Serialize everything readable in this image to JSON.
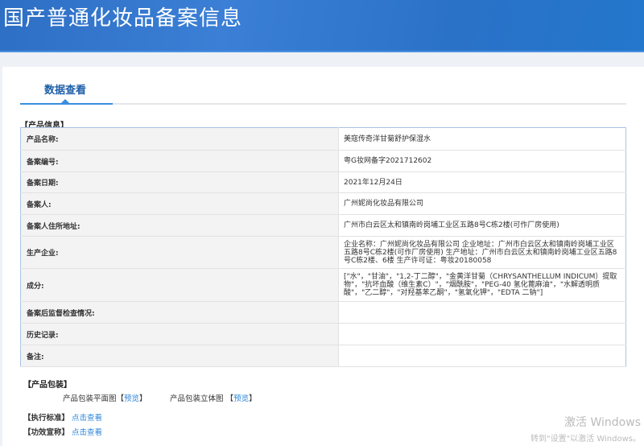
{
  "header": {
    "title": "国产普通化妆品备案信息"
  },
  "tabs": [
    {
      "label": "数据查看",
      "active": true
    }
  ],
  "product_info": {
    "section_title": "【产品信息】",
    "rows": [
      {
        "label": "产品名称:",
        "value": "美寇传奇洋甘菊舒护保湿水"
      },
      {
        "label": "备案编号:",
        "value": "粤G妆网备字2021712602"
      },
      {
        "label": "备案日期:",
        "value": "2021年12月24日"
      },
      {
        "label": "备案人:",
        "value": "广州妮尚化妆品有限公司"
      },
      {
        "label": "备案人住所地址:",
        "value": "广州市白云区太和镇南岭岗埔工业区五路8号C栋2楼(可作厂房使用)"
      },
      {
        "label": "生产企业:",
        "value": "企业名称：广州妮尚化妆品有限公司 企业地址：广州市白云区太和镇南岭岗埔工业区五路8号C栋2楼(可作厂房使用)  生产地址：广州市白云区太和镇南岭岗埔工业区五路8号C栋2楼、6楼 生产许可证：粤妆20180058"
      },
      {
        "label": "成分:",
        "value": "[\"水\"，\"甘油\"，\"1,2-丁二醇\"，\"金黄洋甘菊（CHRYSANTHELLUM INDICUM）提取物\"，\"抗坏血酸（维生素C）\"，\"烟酰胺\"，\"PEG-40 氢化蓖麻油\"，\"水解透明质酸\"，\"乙二醇\"，\"对羟基苯乙酮\"，\"氢氧化钾\"，\"EDTA 二钠\"]"
      },
      {
        "label": "备案后监督检查情况:",
        "value": ""
      },
      {
        "label": "历史记录:",
        "value": ""
      },
      {
        "label": "备注:",
        "value": ""
      }
    ]
  },
  "packaging": {
    "section_title": "【产品包装】",
    "flat_label": "产品包装平面图",
    "flat_link": "预览",
    "solid_label": "产品包装立体图",
    "solid_link": "预览",
    "bracket_open": "【",
    "bracket_close": "】"
  },
  "standard": {
    "label": "【执行标准】",
    "link": "点击查看"
  },
  "efficacy": {
    "label": "【功效宣称】",
    "link": "点击查看"
  },
  "watermark": {
    "line1": "激活 Windows",
    "line2": "转到\"设置\"以激活 Windows。"
  }
}
